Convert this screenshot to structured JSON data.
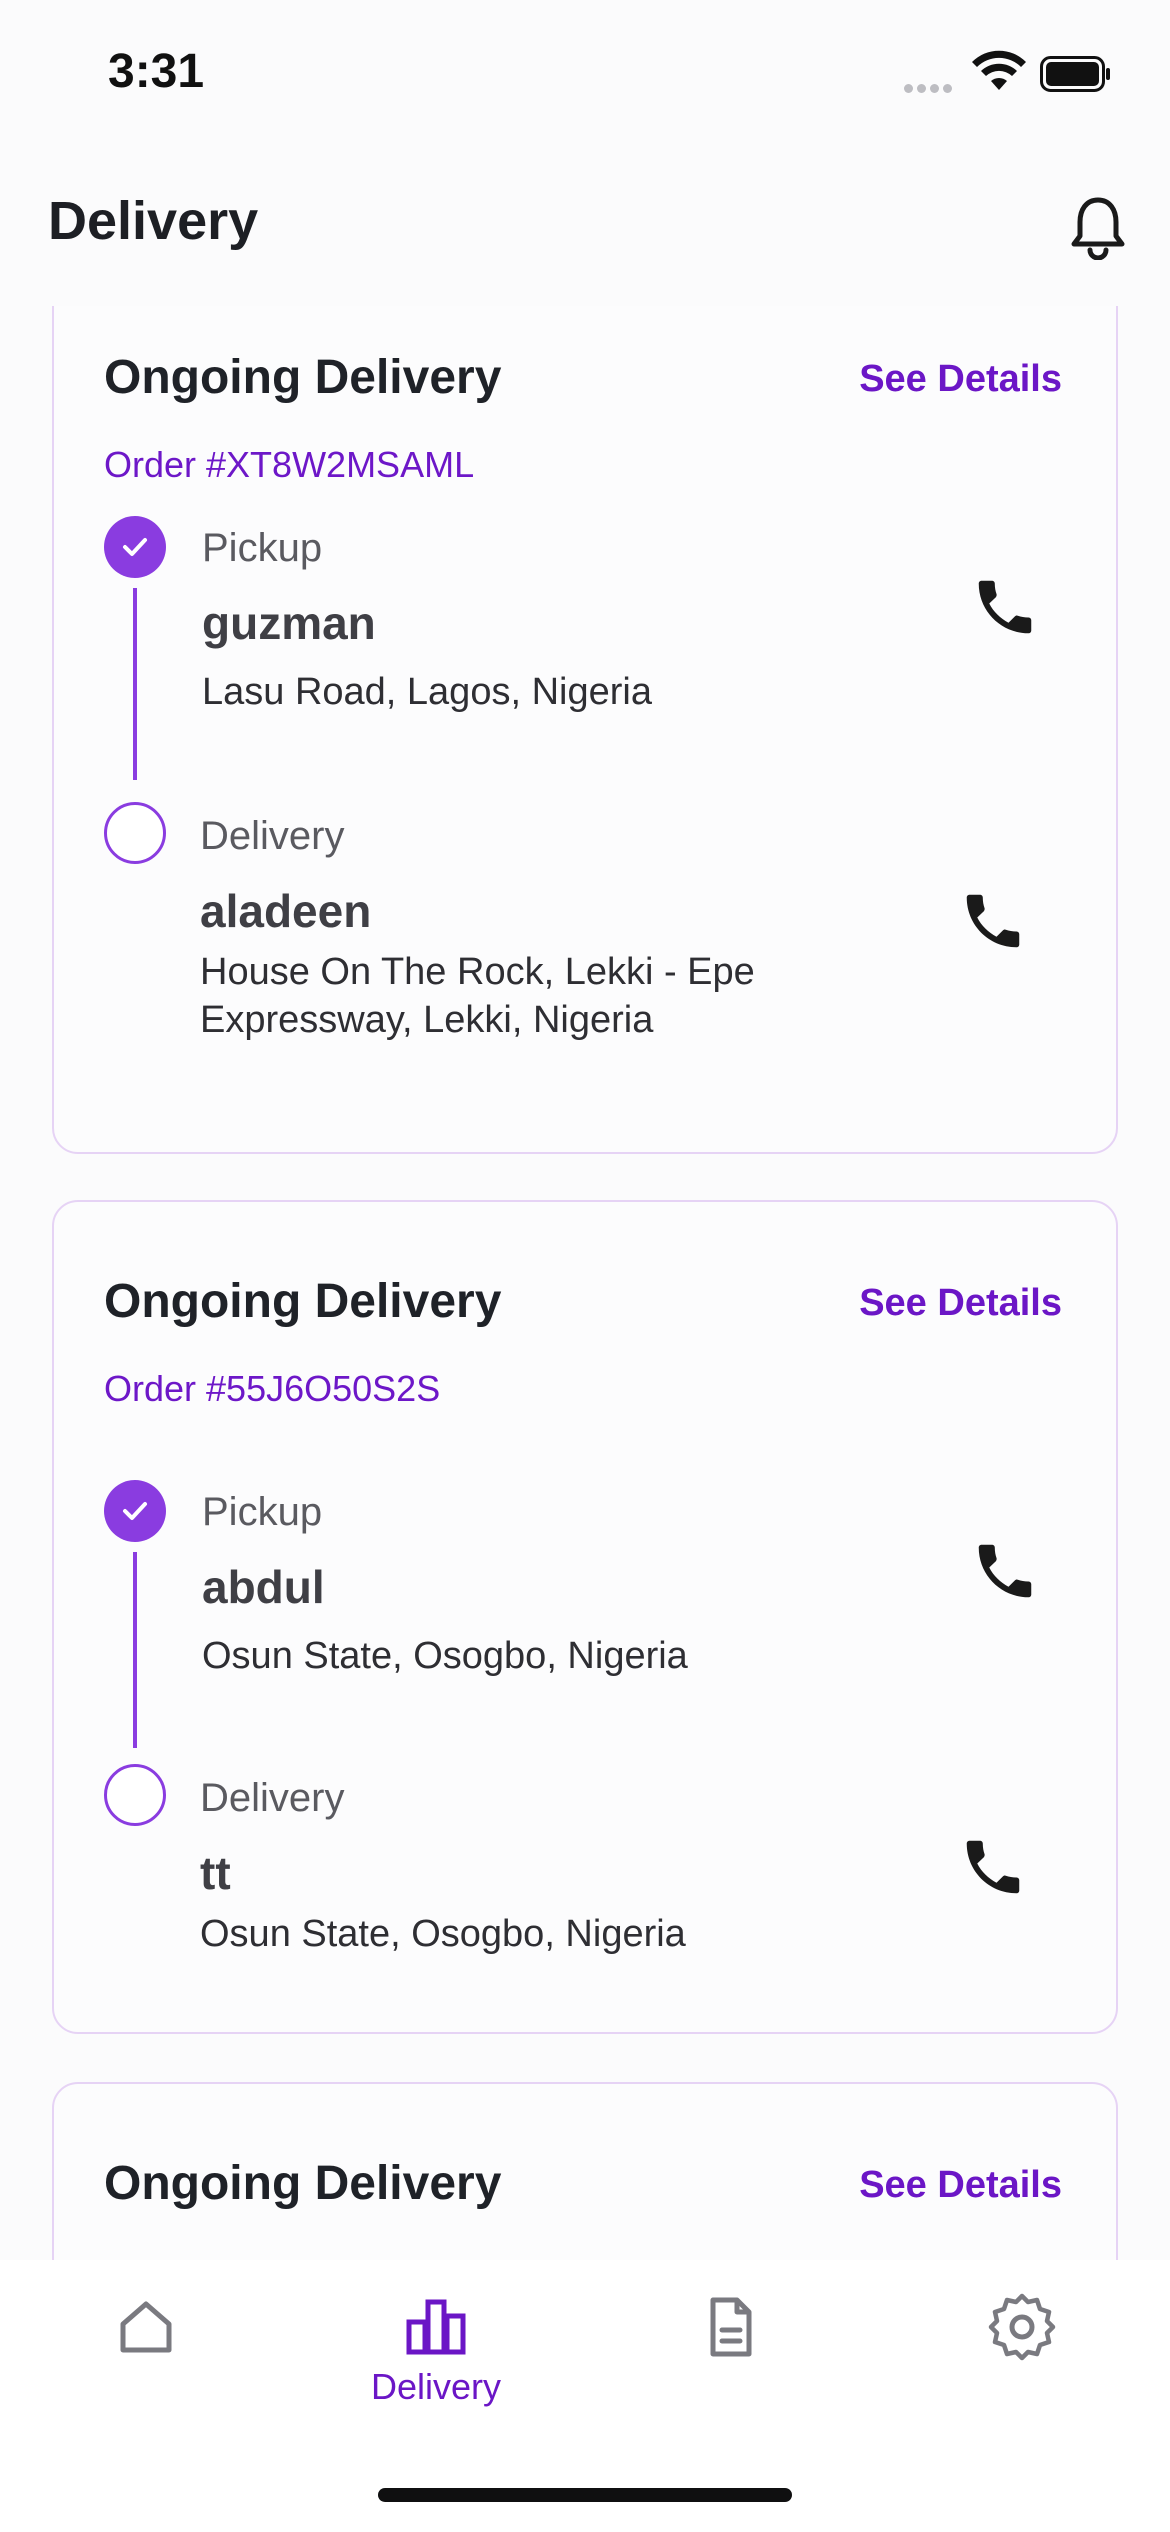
{
  "status_bar": {
    "time": "3:31"
  },
  "header": {
    "title": "Delivery"
  },
  "deliveries": [
    {
      "title": "Ongoing Delivery",
      "see_details": "See Details",
      "order": "Order #XT8W2MSAML",
      "pickup": {
        "label": "Pickup",
        "name": "guzman",
        "address": "Lasu Road, Lagos, Nigeria"
      },
      "delivery": {
        "label": "Delivery",
        "name": "aladeen",
        "address": "House On The Rock, Lekki - Epe Expressway, Lekki, Nigeria"
      }
    },
    {
      "title": "Ongoing Delivery",
      "see_details": "See Details",
      "order": "Order #55J6O50S2S",
      "pickup": {
        "label": "Pickup",
        "name": "abdul",
        "address": "Osun State, Osogbo, Nigeria"
      },
      "delivery": {
        "label": "Delivery",
        "name": "tt",
        "address": "Osun State, Osogbo, Nigeria"
      }
    },
    {
      "title": "Ongoing Delivery",
      "see_details": "See Details"
    }
  ],
  "bottom_nav": {
    "items": [
      {
        "icon": "home-icon",
        "label": ""
      },
      {
        "icon": "bar-chart-icon",
        "label": "Delivery",
        "active": true
      },
      {
        "icon": "document-icon",
        "label": ""
      },
      {
        "icon": "settings-icon",
        "label": ""
      }
    ]
  },
  "colors": {
    "accent": "#8a3ce0",
    "accent_text": "#6b16c6",
    "card_border": "#e6d3f5"
  }
}
